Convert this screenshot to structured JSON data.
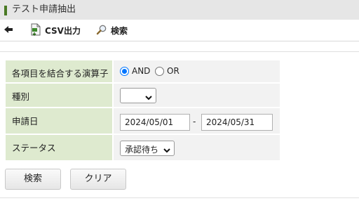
{
  "window": {
    "title": "テスト申請抽出"
  },
  "toolbar": {
    "back_icon": "arrow-left-icon",
    "csv_label": "CSV出力",
    "csv_icon": "csv-file-icon",
    "search_label": "検索",
    "search_icon": "magnifier-icon"
  },
  "form": {
    "operator": {
      "label": "各項目を結合する演算子",
      "options": [
        "AND",
        "OR"
      ],
      "selected": "AND"
    },
    "kind": {
      "label": "種別",
      "value": ""
    },
    "apply_date": {
      "label": "申請日",
      "from": "2024/05/01",
      "separator": "-",
      "to": "2024/05/31"
    },
    "status": {
      "label": "ステータス",
      "value": "承認待ち"
    }
  },
  "actions": {
    "search_label": "検索",
    "clear_label": "クリア"
  },
  "colors": {
    "label_bg": "#deeacf",
    "value_bg": "#f2f2f2",
    "accent": "#0075ff",
    "title_mark": "#4a7a24"
  }
}
